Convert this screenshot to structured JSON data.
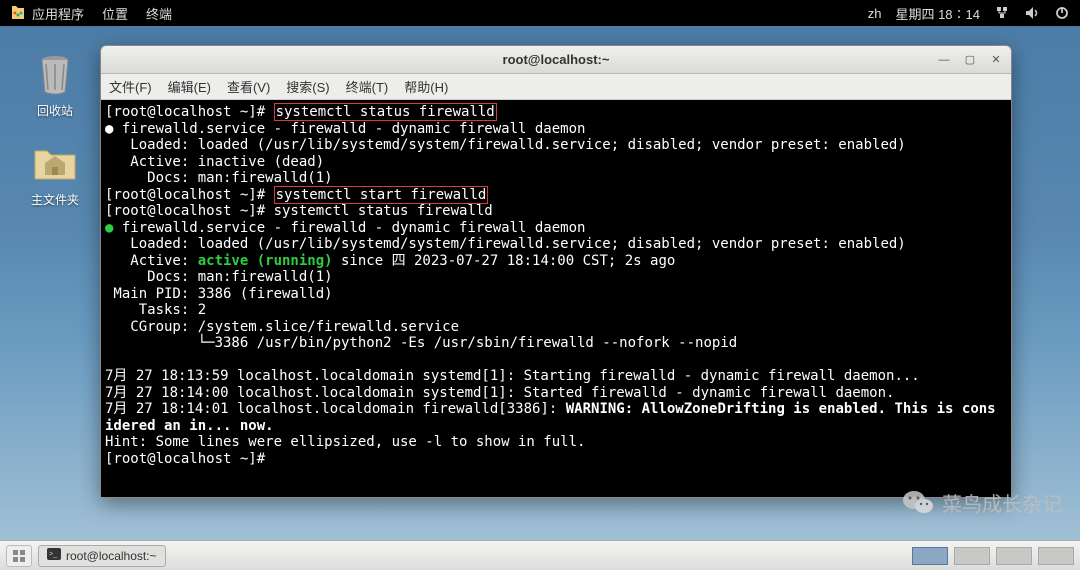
{
  "topbar": {
    "menu": {
      "apps": "应用程序",
      "places": "位置",
      "terminal": "终端"
    },
    "lang": "zh",
    "datetime": "星期四 18∶14"
  },
  "desktop": {
    "trash": "回收站",
    "home": "主文件夹"
  },
  "window": {
    "title": "root@localhost:~",
    "menus": {
      "file": "文件(F)",
      "edit": "编辑(E)",
      "view": "查看(V)",
      "search": "搜索(S)",
      "terminal": "终端(T)",
      "help": "帮助(H)"
    }
  },
  "terminal": {
    "prompt": "[root@localhost ~]# ",
    "cmd1": "systemctl status firewalld",
    "service_line": "firewalld.service - firewalld - dynamic firewall daemon",
    "loaded": "   Loaded: loaded (/usr/lib/systemd/system/firewalld.service; disabled; vendor preset: enabled)",
    "active_dead": "   Active: inactive (dead)",
    "docs": "     Docs: man:firewalld(1)",
    "cmd2": "systemctl start firewalld",
    "cmd3": "systemctl status firewalld",
    "active_pre": "   Active: ",
    "active_run": "active (running)",
    "active_post": " since 四 2023-07-27 18:14:00 CST; 2s ago",
    "mainpid": " Main PID: 3386 (firewalld)",
    "tasks": "    Tasks: 2",
    "cgroup": "   CGroup: /system.slice/firewalld.service",
    "cgroup2": "           └─3386 /usr/bin/python2 -Es /usr/sbin/firewalld --nofork --nopid",
    "log1": "7月 27 18:13:59 localhost.localdomain systemd[1]: Starting firewalld - dynamic firewall daemon...",
    "log2": "7月 27 18:14:00 localhost.localdomain systemd[1]: Started firewalld - dynamic firewall daemon.",
    "log3a": "7月 27 18:14:01 localhost.localdomain firewalld[3386]: ",
    "log3b": "WARNING: AllowZoneDrifting is enabled. This is cons",
    "log3c": "idered an in... now.",
    "hint": "Hint: Some lines were ellipsized, use -l to show in full."
  },
  "watermark": "菜鸟成长杂记",
  "taskbar": {
    "item": "root@localhost:~"
  }
}
